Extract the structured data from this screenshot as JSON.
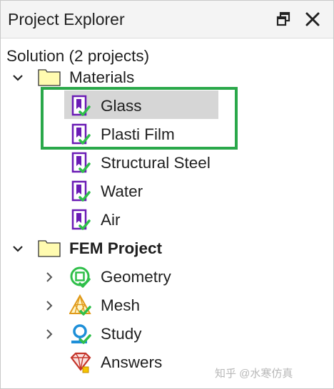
{
  "window": {
    "title": "Project Explorer",
    "restore_icon": "restore-window-icon",
    "close_icon": "close-icon"
  },
  "tree": {
    "root_label": "Solution (2 projects)",
    "materials": {
      "label": "Materials",
      "expanded": true,
      "items": [
        {
          "label": "Glass",
          "icon": "material-icon",
          "selected": true
        },
        {
          "label": "Plasti Film",
          "icon": "material-icon"
        },
        {
          "label": "Structural Steel",
          "icon": "material-icon"
        },
        {
          "label": "Water",
          "icon": "material-icon"
        },
        {
          "label": "Air",
          "icon": "material-icon"
        }
      ]
    },
    "fem_project": {
      "label": "FEM Project",
      "expanded": true,
      "items": [
        {
          "label": "Geometry",
          "icon": "geometry-icon",
          "expandable": true
        },
        {
          "label": "Mesh",
          "icon": "mesh-icon",
          "expandable": true
        },
        {
          "label": "Study",
          "icon": "study-icon",
          "expandable": true
        },
        {
          "label": "Answers",
          "icon": "answers-icon",
          "expandable": false
        }
      ]
    }
  },
  "annotation": {
    "highlight_color": "#2aa84a"
  },
  "watermark": "知乎 @水寒仿真"
}
